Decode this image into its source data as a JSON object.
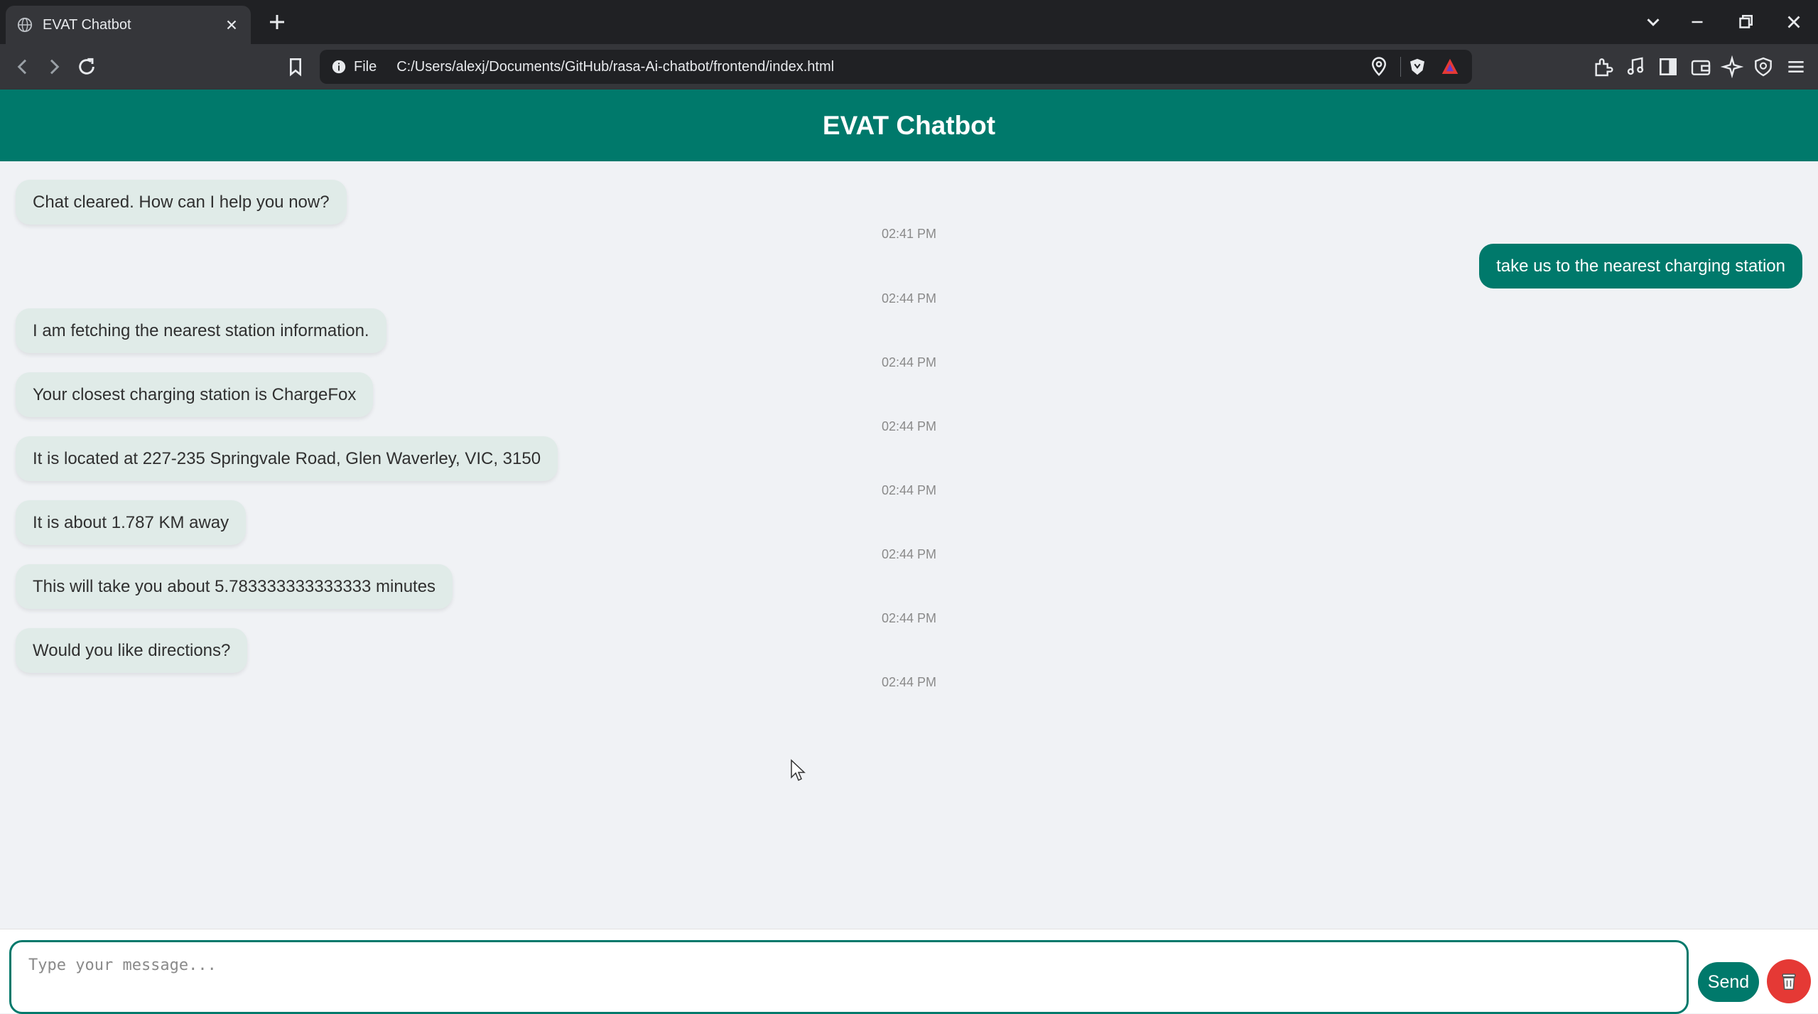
{
  "browser": {
    "tab_title": "EVAT Chatbot",
    "file_label": "File",
    "url": "C:/Users/alexj/Documents/GitHub/rasa-Ai-chatbot/frontend/index.html"
  },
  "app": {
    "title": "EVAT Chatbot"
  },
  "chat": {
    "messages": [
      {
        "sender": "bot",
        "text": "Chat cleared. How can I help you now?",
        "time": "02:41 PM"
      },
      {
        "sender": "user",
        "text": "take us to the  nearest charging station",
        "time": "02:44 PM"
      },
      {
        "sender": "bot",
        "text": "I am fetching the nearest station information.",
        "time": "02:44 PM"
      },
      {
        "sender": "bot",
        "text": "Your closest charging station is ChargeFox",
        "time": "02:44 PM"
      },
      {
        "sender": "bot",
        "text": "It is located at 227-235 Springvale Road, Glen Waverley, VIC, 3150",
        "time": "02:44 PM"
      },
      {
        "sender": "bot",
        "text": "It is about 1.787 KM away",
        "time": "02:44 PM"
      },
      {
        "sender": "bot",
        "text": "This will take you about 5.783333333333333 minutes",
        "time": "02:44 PM"
      },
      {
        "sender": "bot",
        "text": "Would you like directions?",
        "time": "02:44 PM"
      }
    ]
  },
  "input": {
    "placeholder": "Type your message...",
    "value": "",
    "send_label": "Send"
  },
  "colors": {
    "brand": "#00796b",
    "bot_bubble": "#e0ebe8",
    "clear_button": "#e53935",
    "page_background": "#f0f2f5"
  },
  "icons": {
    "tab": "globe-icon",
    "clear": "trash-icon"
  }
}
